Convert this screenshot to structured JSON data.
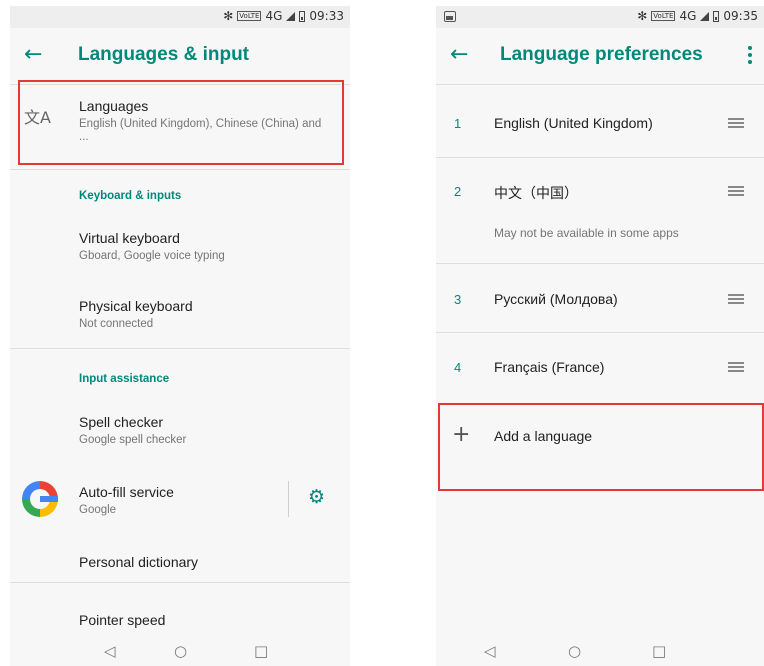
{
  "left": {
    "status": {
      "time": "09:33",
      "network": "4G",
      "volte": "VoLTE"
    },
    "appbar": {
      "title": "Languages & input"
    },
    "languages": {
      "title": "Languages",
      "subtitle": "English (United Kingdom), Chinese (China) and ..."
    },
    "keyboard_section": {
      "header": "Keyboard & inputs"
    },
    "virtual_keyboard": {
      "title": "Virtual keyboard",
      "subtitle": "Gboard, Google voice typing"
    },
    "physical_keyboard": {
      "title": "Physical keyboard",
      "subtitle": "Not connected"
    },
    "assist_section": {
      "header": "Input assistance"
    },
    "spell_checker": {
      "title": "Spell checker",
      "subtitle": "Google spell checker"
    },
    "autofill": {
      "title": "Auto-fill service",
      "subtitle": "Google"
    },
    "personal_dictionary": {
      "title": "Personal dictionary"
    },
    "pointer_speed": {
      "title": "Pointer speed"
    }
  },
  "right": {
    "status": {
      "time": "09:35",
      "network": "4G",
      "volte": "VoLTE"
    },
    "appbar": {
      "title": "Language preferences"
    },
    "languages": [
      {
        "num": "1",
        "name": "English (United Kingdom)"
      },
      {
        "num": "2",
        "name": "中文（中国）",
        "note": "May not be available in some apps"
      },
      {
        "num": "3",
        "name": "Русский (Молдова)"
      },
      {
        "num": "4",
        "name": "Français (France)"
      }
    ],
    "add_language": {
      "label": "Add a language"
    }
  },
  "nav": {
    "back": "◁",
    "home": "○",
    "recents": "□"
  },
  "icons": {
    "back": "←",
    "translate": "文A",
    "gear": "⚙",
    "plus": "+",
    "bluetooth": "✻"
  },
  "colors": {
    "accent": "#00897b",
    "highlight": "#e53935"
  }
}
